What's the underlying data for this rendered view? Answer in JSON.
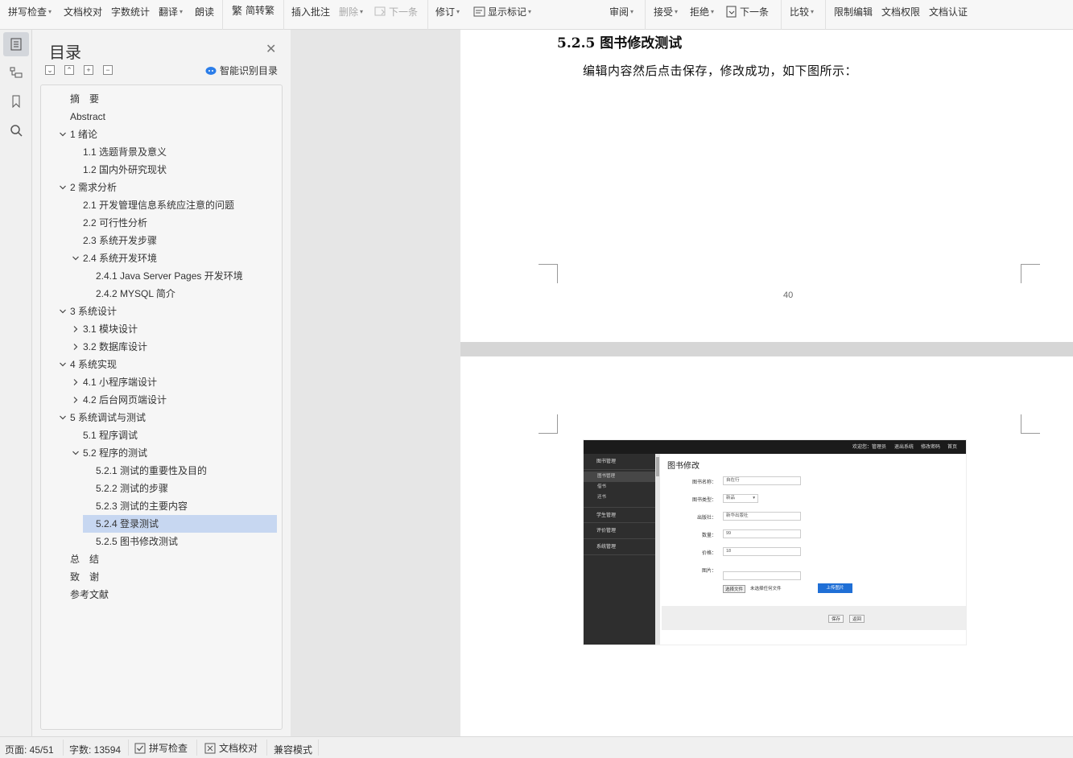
{
  "ribbon": {
    "items": [
      {
        "label": "拼写检查",
        "caret": true,
        "enabled": true
      },
      {
        "label": "文档校对",
        "caret": false,
        "enabled": true
      },
      {
        "label": "字数统计",
        "caret": false,
        "enabled": true
      },
      {
        "label": "翻译",
        "caret": true,
        "enabled": true
      },
      {
        "label": "朗读",
        "caret": false,
        "enabled": true
      },
      {
        "label": "简转繁",
        "caret": false,
        "enabled": true
      },
      {
        "label": "插入批注",
        "caret": false,
        "enabled": true
      },
      {
        "label": "删除",
        "caret": true,
        "enabled": false
      },
      {
        "label": "下一条",
        "caret": false,
        "enabled": false
      },
      {
        "label": "修订",
        "caret": true,
        "enabled": true
      },
      {
        "label": "显示标记",
        "caret": true,
        "enabled": true
      },
      {
        "label": "审阅",
        "caret": true,
        "enabled": true
      },
      {
        "label": "接受",
        "caret": true,
        "enabled": true
      },
      {
        "label": "拒绝",
        "caret": true,
        "enabled": true
      },
      {
        "label": "下一条",
        "caret": false,
        "enabled": true
      },
      {
        "label": "比较",
        "caret": true,
        "enabled": true
      },
      {
        "label": "限制编辑",
        "caret": false,
        "enabled": true
      },
      {
        "label": "文档权限",
        "caret": false,
        "enabled": true
      },
      {
        "label": "文档认证",
        "caret": false,
        "enabled": true
      }
    ]
  },
  "toc": {
    "title": "目录",
    "smart_label": "智能识别目录",
    "items": [
      {
        "label": "摘　要",
        "level": 0,
        "toggle": "none"
      },
      {
        "label": "Abstract",
        "level": 0,
        "toggle": "none"
      },
      {
        "label": "1 绪论",
        "level": 0,
        "toggle": "open"
      },
      {
        "label": "1.1  选题背景及意义",
        "level": 1,
        "toggle": "none"
      },
      {
        "label": "1.2  国内外研究现状",
        "level": 1,
        "toggle": "none"
      },
      {
        "label": "2 需求分析",
        "level": 0,
        "toggle": "open"
      },
      {
        "label": "2.1 开发管理信息系统应注意的问题",
        "level": 1,
        "toggle": "none"
      },
      {
        "label": "2.2 可行性分析",
        "level": 1,
        "toggle": "none"
      },
      {
        "label": "2.3 系统开发步骤",
        "level": 1,
        "toggle": "none"
      },
      {
        "label": "2.4 系统开发环境",
        "level": 1,
        "toggle": "open"
      },
      {
        "label": "2.4.1 Java Server Pages 开发环境",
        "level": 2,
        "toggle": "none"
      },
      {
        "label": "2.4.2 MYSQL 简介",
        "level": 2,
        "toggle": "none"
      },
      {
        "label": "3 系统设计",
        "level": 0,
        "toggle": "open"
      },
      {
        "label": "3.1  模块设计",
        "level": 1,
        "toggle": "closed"
      },
      {
        "label": "3.2 数据库设计",
        "level": 1,
        "toggle": "closed"
      },
      {
        "label": "4 系统实现",
        "level": 0,
        "toggle": "open"
      },
      {
        "label": "4.1 小程序端设计",
        "level": 1,
        "toggle": "closed"
      },
      {
        "label": "4.2 后台网页端设计",
        "level": 1,
        "toggle": "closed"
      },
      {
        "label": "5 系统调试与测试",
        "level": 0,
        "toggle": "open"
      },
      {
        "label": "5.1  程序调试",
        "level": 1,
        "toggle": "none"
      },
      {
        "label": "5.2  程序的测试",
        "level": 1,
        "toggle": "open"
      },
      {
        "label": "5.2.1  测试的重要性及目的",
        "level": 2,
        "toggle": "none"
      },
      {
        "label": "5.2.2  测试的步骤",
        "level": 2,
        "toggle": "none"
      },
      {
        "label": "5.2.3  测试的主要内容",
        "level": 2,
        "toggle": "none"
      },
      {
        "label": "5.2.4 登录测试",
        "level": 2,
        "toggle": "none",
        "highlight": true
      },
      {
        "label": "5.2.5 图书修改测试",
        "level": 2,
        "toggle": "none"
      },
      {
        "label": "总　结",
        "level": 0,
        "toggle": "none"
      },
      {
        "label": "致　谢",
        "level": 0,
        "toggle": "none"
      },
      {
        "label": "参考文献",
        "level": 0,
        "toggle": "none"
      }
    ]
  },
  "document": {
    "heading": "5.2.5 图书修改测试",
    "paragraph": "编辑内容然后点击保存，修改成功，如下图所示：",
    "page_number": "40"
  },
  "screenshot": {
    "top_links": [
      "欢迎您：管理员",
      "退出系统",
      "修改密码",
      "首页"
    ],
    "side_menu": [
      {
        "label": "图书管理",
        "sub": [
          "图书管理",
          "借书",
          "还书"
        ]
      },
      {
        "label": "学生管理"
      },
      {
        "label": "评价管理"
      },
      {
        "label": "系统管理"
      }
    ],
    "form_title": "图书修改",
    "fields": [
      {
        "label": "图书名称：",
        "value": "自在行"
      },
      {
        "label": "图书类型：",
        "value": "新品"
      },
      {
        "label": "出版社：",
        "value": "新华出版社"
      },
      {
        "label": "数量：",
        "value": "99"
      },
      {
        "label": "价格：",
        "value": "18"
      },
      {
        "label": "图片：",
        "value": ""
      }
    ],
    "choose_file": "选择文件",
    "no_file": "未选择任何文件",
    "upload": "上传图片",
    "save": "保存",
    "back": "返回"
  },
  "status": {
    "page": "页面: 45/51",
    "words": "字数: 13594",
    "spell": "拼写检查",
    "proof": "文档校对",
    "compat": "兼容模式"
  },
  "colors": {
    "highlight": "#c7d7f1",
    "accent": "#2b7de9"
  }
}
